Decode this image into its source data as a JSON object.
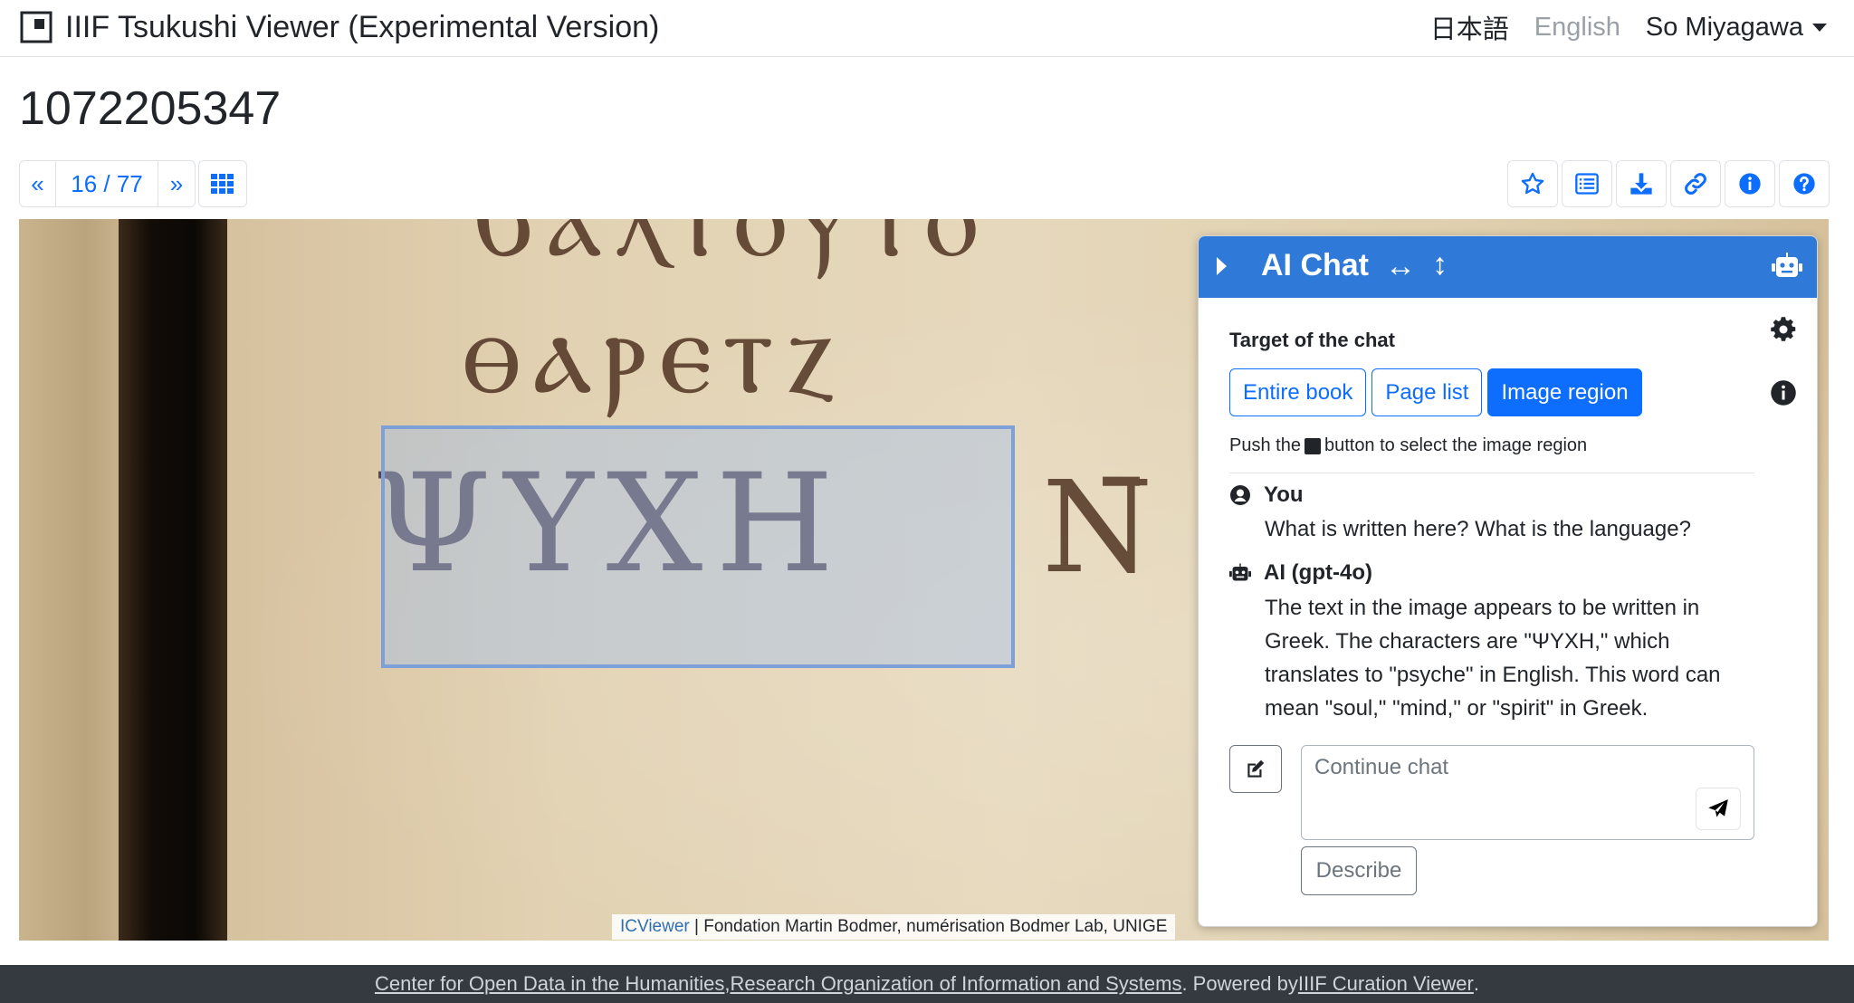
{
  "navbar": {
    "title": "IIIF Tsukushi Viewer (Experimental Version)",
    "lang_ja": "日本語",
    "lang_en": "English",
    "user": "So Miyagawa"
  },
  "page": {
    "title": "1072205347"
  },
  "pager": {
    "prev": "«",
    "count": "16 / 77",
    "next": "»"
  },
  "toolbar_icons": [
    "star-icon",
    "list-icon",
    "download-icon",
    "link-icon",
    "info-icon",
    "help-icon"
  ],
  "viewer": {
    "manuscript_lines": [
      "ϐⲁⲗⲧⲟⲩⲧⲟ",
      "ⲑⲁⲣⲉⲧⲍ",
      "ΨΥΧΗ",
      "Ν̄"
    ],
    "attribution_link": "ICViewer",
    "attribution_text": " | Fondation Martin Bodmer, numérisation Bodmer Lab, UNIGE"
  },
  "chat": {
    "title": "AI Chat",
    "horizontal_resize": "↔",
    "vertical_resize": "↕",
    "target_label": "Target of the chat",
    "target_options": [
      "Entire book",
      "Page list",
      "Image region"
    ],
    "active_target": "Image region",
    "hint_before": "Push the",
    "hint_after": "button to select the image region",
    "messages": [
      {
        "author": "You",
        "text": "What is written here? What is the language?"
      },
      {
        "author": "AI (gpt-4o)",
        "text": "The text in the image appears to be written in Greek. The characters are \"ΨΥΧΗ,\" which translates to \"psyche\" in English. This word can mean \"soul,\" \"mind,\" or \"spirit\" in Greek."
      }
    ],
    "input_placeholder": "Continue chat",
    "describe_label": "Describe"
  },
  "footer": {
    "link1": "Center for Open Data in the Humanities",
    "sep": ", ",
    "link2": "Research Organization of Information and Systems",
    "powered": ". Powered by ",
    "link3": "IIIF Curation Viewer",
    "end": "."
  },
  "colors": {
    "primary": "#0d6efd",
    "chat_header": "#2f79d8",
    "footer_bg": "#343a40",
    "selection": "#7ea0d8"
  }
}
